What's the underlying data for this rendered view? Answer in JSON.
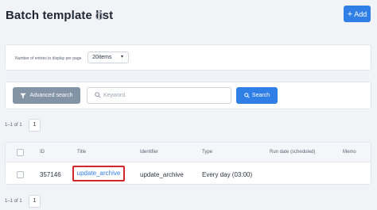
{
  "header": {
    "title": "Batch template list",
    "help_icon": "?",
    "add_label": "Add",
    "add_icon": "+"
  },
  "perpage": {
    "label": "Number of entries to display per page",
    "selected": "20items",
    "caret": "▾"
  },
  "search": {
    "advanced_label": "Advanced search",
    "keyword_placeholder": "Keyword",
    "keyword_value": "",
    "search_label": "Search"
  },
  "pagination": {
    "count_text": "1–1 of 1",
    "page": "1"
  },
  "table": {
    "headers": {
      "id": "ID",
      "title": "Title",
      "identifier": "Identifier",
      "type": "Type",
      "run_date": "Run date (scheduled)",
      "memo": "Memo"
    },
    "rows": [
      {
        "id": "357146",
        "title": "update_archive",
        "identifier": "update_archive",
        "type": "Every day (03:00)",
        "run_date": "",
        "memo": ""
      }
    ]
  },
  "colors": {
    "primary": "#2f7fe6",
    "secondary_button": "#8494a7",
    "highlight_border": "#d6252a",
    "background": "#f1f3f6"
  }
}
